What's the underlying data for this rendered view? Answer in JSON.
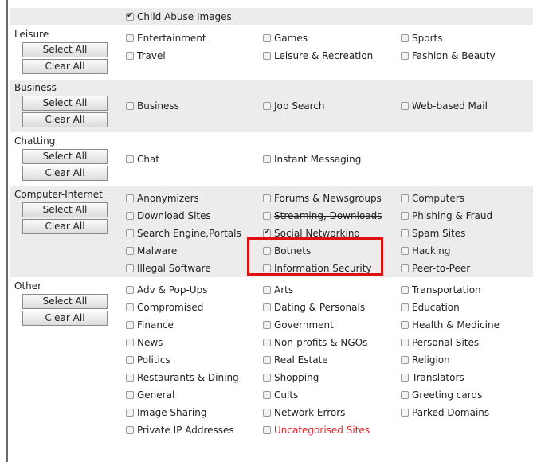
{
  "top": {
    "label": "Child Abuse Images",
    "checked": true
  },
  "buttons": {
    "select_all": "Select All",
    "clear_all": "Clear All"
  },
  "groups": [
    {
      "name": "Leisure",
      "rows": [
        [
          {
            "label": "Entertainment",
            "checked": false
          },
          {
            "label": "Games",
            "checked": false
          },
          {
            "label": "Sports",
            "checked": false
          }
        ],
        [
          {
            "label": "Travel",
            "checked": false
          },
          {
            "label": "Leisure & Recreation",
            "checked": false
          },
          {
            "label": "Fashion & Beauty",
            "checked": false
          }
        ]
      ]
    },
    {
      "name": "Business",
      "rows": [
        [
          {
            "label": "Business",
            "checked": false
          },
          {
            "label": "Job Search",
            "checked": false
          },
          {
            "label": "Web-based Mail",
            "checked": false
          }
        ]
      ]
    },
    {
      "name": "Chatting",
      "rows": [
        [
          {
            "label": "Chat",
            "checked": false
          },
          {
            "label": "Instant Messaging",
            "checked": false
          }
        ]
      ]
    },
    {
      "name": "Computer-Internet",
      "rows": [
        [
          {
            "label": "Anonymizers",
            "checked": false
          },
          {
            "label": "Forums & Newsgroups",
            "checked": false
          },
          {
            "label": "Computers",
            "checked": false
          }
        ],
        [
          {
            "label": "Download Sites",
            "checked": false
          },
          {
            "label": "Streaming, Downloads",
            "checked": false
          },
          {
            "label": "Phishing & Fraud",
            "checked": false
          }
        ],
        [
          {
            "label": "Search Engine,Portals",
            "checked": false
          },
          {
            "label": "Social Networking",
            "checked": true
          },
          {
            "label": "Spam Sites",
            "checked": false
          }
        ],
        [
          {
            "label": "Malware",
            "checked": false
          },
          {
            "label": "Botnets",
            "checked": false
          },
          {
            "label": "Hacking",
            "checked": false
          }
        ],
        [
          {
            "label": "Illegal Software",
            "checked": false
          },
          {
            "label": "Information Security",
            "checked": false
          },
          {
            "label": "Peer-to-Peer",
            "checked": false
          }
        ]
      ]
    },
    {
      "name": "Other",
      "rows": [
        [
          {
            "label": "Adv & Pop-Ups",
            "checked": false
          },
          {
            "label": "Arts",
            "checked": false
          },
          {
            "label": "Transportation",
            "checked": false
          }
        ],
        [
          {
            "label": "Compromised",
            "checked": false
          },
          {
            "label": "Dating & Personals",
            "checked": false
          },
          {
            "label": "Education",
            "checked": false
          }
        ],
        [
          {
            "label": "Finance",
            "checked": false
          },
          {
            "label": "Government",
            "checked": false
          },
          {
            "label": "Health & Medicine",
            "checked": false
          }
        ],
        [
          {
            "label": "News",
            "checked": false
          },
          {
            "label": "Non-profits & NGOs",
            "checked": false
          },
          {
            "label": "Personal Sites",
            "checked": false
          }
        ],
        [
          {
            "label": "Politics",
            "checked": false
          },
          {
            "label": "Real Estate",
            "checked": false
          },
          {
            "label": "Religion",
            "checked": false
          }
        ],
        [
          {
            "label": "Restaurants & Dining",
            "checked": false
          },
          {
            "label": "Shopping",
            "checked": false
          },
          {
            "label": "Translators",
            "checked": false
          }
        ],
        [
          {
            "label": "General",
            "checked": false
          },
          {
            "label": "Cults",
            "checked": false
          },
          {
            "label": "Greeting cards",
            "checked": false
          }
        ],
        [
          {
            "label": "Image Sharing",
            "checked": false
          },
          {
            "label": "Network Errors",
            "checked": false
          },
          {
            "label": "Parked Domains",
            "checked": false
          }
        ],
        [
          {
            "label": "Private IP Addresses",
            "checked": false
          },
          {
            "label": "Uncategorised Sites",
            "checked": false,
            "color": "#e02424"
          }
        ]
      ]
    }
  ],
  "colors": {
    "shaded_bg": "#ececec",
    "highlight": "#e01010",
    "warning_text": "#e02424"
  }
}
